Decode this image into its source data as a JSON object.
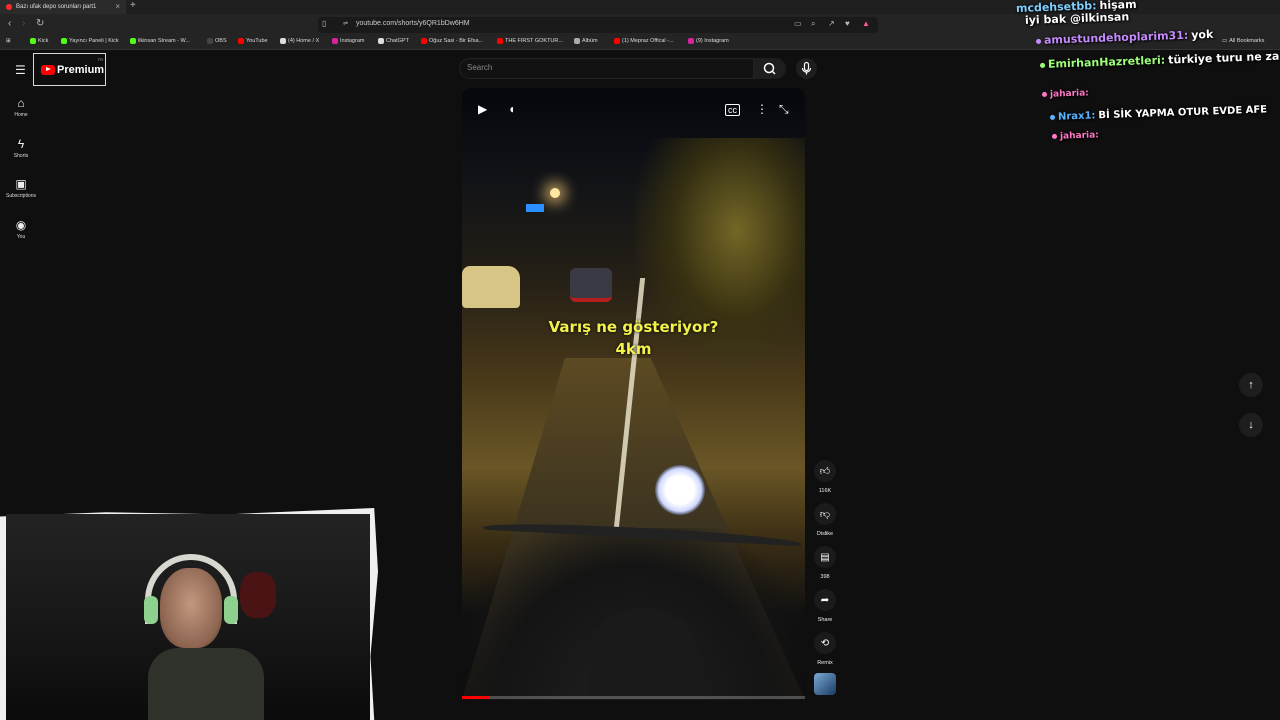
{
  "browser": {
    "tab_title": "Bazı ufak depo sorunları part1",
    "tab_close": "×",
    "new_tab": "+",
    "url": "youtube.com/shorts/y6QR1bDw6HM",
    "all_bookmarks": "All Bookmarks",
    "bookmarks": [
      {
        "label": "Kick",
        "color": "#53fc18"
      },
      {
        "label": "Yayıncı Paneli | Kick",
        "color": "#53fc18"
      },
      {
        "label": "ilkinsan Stream - W...",
        "color": "#53fc18"
      },
      {
        "label": "OBS",
        "color": "#444444"
      },
      {
        "label": "YouTube",
        "color": "#ff0000"
      },
      {
        "label": "(4) Home / X",
        "color": "#dddddd"
      },
      {
        "label": "Instagram",
        "color": "#d6249f"
      },
      {
        "label": "ChatGPT",
        "color": "#dddddd"
      },
      {
        "label": "Oğuz Sasi - Bir Efsa...",
        "color": "#ff0000"
      },
      {
        "label": "THE FIRST GOKTUR...",
        "color": "#ff0000"
      },
      {
        "label": "Albüm",
        "color": "#aaaaaa"
      },
      {
        "label": "(1) Mepraz Offical -...",
        "color": "#ff0000"
      },
      {
        "label": "(9) Instagram",
        "color": "#d6249f"
      }
    ]
  },
  "youtube": {
    "logo_text": "Premium",
    "logo_badge": "TR",
    "search_placeholder": "Search",
    "sidebar": [
      {
        "label": "Home",
        "icon": "⌂"
      },
      {
        "label": "Shorts",
        "icon": "ϟ"
      },
      {
        "label": "Subscriptions",
        "icon": "▣"
      },
      {
        "label": "You",
        "icon": "◉"
      }
    ],
    "video": {
      "caption_line1": "Varış ne gösteriyor?",
      "caption_line2": "4km",
      "progress": 0.08
    },
    "actions": {
      "likes": "116K",
      "dislike_label": "Dislike",
      "comments": "398",
      "share_label": "Share",
      "remix_label": "Remix"
    }
  },
  "chat": [
    {
      "user": "mcdehsetbb:",
      "msg": "hişam",
      "color": "#7fd0ff"
    },
    {
      "user": "",
      "msg": "iyi bak @ilkinsan",
      "color": "#ffffff"
    },
    {
      "user": "amustundehoplarim31:",
      "msg": "yok",
      "color": "#c68cff"
    },
    {
      "user": "EmirhanHazretleri:",
      "msg": "türkiye turu ne zaman",
      "color": "#9eff7a"
    },
    {
      "user": "jaharia:",
      "msg": "",
      "color": "#ff79c6"
    },
    {
      "user": "Nrax1:",
      "msg": "Bİ SİK YAPMA OTUR EVDE AFE",
      "color": "#5ab4ff"
    },
    {
      "user": "jaharia:",
      "msg": "",
      "color": "#ff79c6"
    }
  ]
}
